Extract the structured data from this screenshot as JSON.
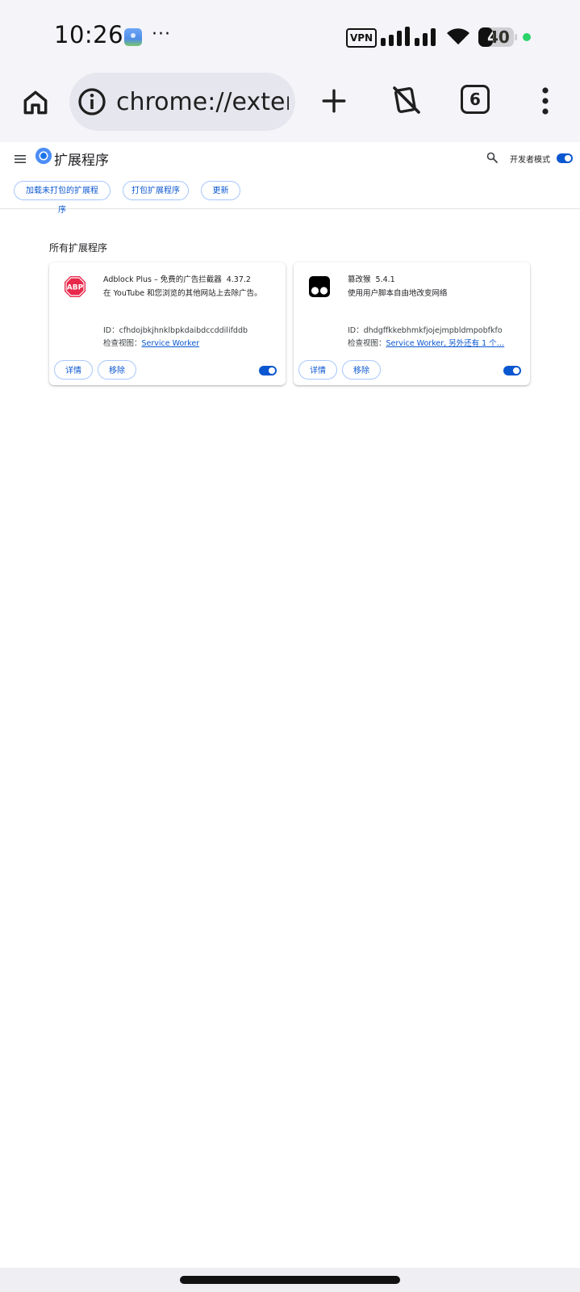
{
  "status_bar": {
    "time": "10:26",
    "more": "···",
    "vpn": "VPN",
    "battery": "40",
    "icons": [
      "app-notification-icon",
      "vpn-icon",
      "signal-icon",
      "wifi-icon",
      "battery-icon",
      "privacy-dot-icon"
    ]
  },
  "browser": {
    "url": "chrome://exter",
    "tab_count": "6",
    "icons": [
      "home-icon",
      "info-icon",
      "plus-icon",
      "rotation-lock-icon",
      "tabs-icon",
      "more-vert-icon"
    ]
  },
  "header": {
    "title": "扩展程序",
    "dev_mode_label": "开发者模式",
    "dev_mode_on": true
  },
  "actions": {
    "load_unpacked": "加载未打包的扩展程序",
    "pack": "打包扩展程序",
    "update": "更新"
  },
  "section": {
    "title": "所有扩展程序"
  },
  "extensions": [
    {
      "name": "Adblock Plus – 免费的广告拦截器",
      "version": "4.37.2",
      "description": "在 YouTube 和您浏览的其他网站上去除广告。",
      "id_label": "ID：",
      "id": "cfhdojbkjhnklbpkdaibdccddilifddb",
      "views_label": "检查视图：",
      "views": "Service Worker",
      "details_label": "详情",
      "remove_label": "移除",
      "enabled": true,
      "icon": "abp-stop-sign-icon",
      "icon_text": "ABP",
      "icon_color": "#e8294b"
    },
    {
      "name": "篡改猴",
      "version": "5.4.1",
      "description": "使用用户脚本自由地改变网络",
      "id_label": "ID：",
      "id": "dhdgffkkebhmkfjojejmpbldmpobfkfo",
      "views_label": "检查视图：",
      "views": "Service Worker, 另外还有 1 个…",
      "details_label": "详情",
      "remove_label": "移除",
      "enabled": true,
      "icon": "tampermonkey-icon"
    }
  ],
  "colors": {
    "accent": "#0b57d0",
    "button_border": "#a8c7fa",
    "chrome_bar": "#f4f4f9",
    "omnibox": "#e6e6ee"
  }
}
